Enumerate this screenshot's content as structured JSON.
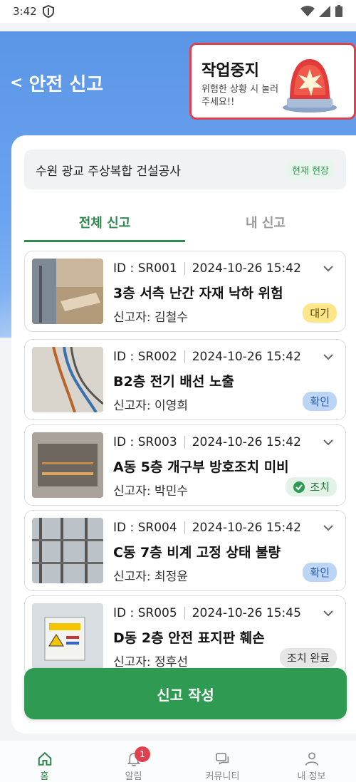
{
  "status_bar": {
    "time": "3:42"
  },
  "header": {
    "back_symbol": "<",
    "title": "안전 신고"
  },
  "stop_work": {
    "title": "작업중지",
    "subtitle": "위험한 상황 시 눌러주세요!!"
  },
  "site": {
    "name": "수원 광교 주상복합 건설공사",
    "badge": "현재 현장"
  },
  "tabs": [
    {
      "label": "전체 신고",
      "active": true
    },
    {
      "label": "내 신고",
      "active": false
    }
  ],
  "reports": [
    {
      "id": "ID : SR001",
      "datetime": "2024-10-26 15:42",
      "title": "3층 서측 난간 자재 낙하 위험",
      "reporter": "신고자: 김철수",
      "status": "대기",
      "status_type": "wait"
    },
    {
      "id": "ID : SR002",
      "datetime": "2024-10-26 15:42",
      "title": "B2층 전기 배선 노출",
      "reporter": "신고자: 이영희",
      "status": "확인",
      "status_type": "confirm"
    },
    {
      "id": "ID : SR003",
      "datetime": "2024-10-26 15:42",
      "title": "A동 5층 개구부 방호조치 미비",
      "reporter": "신고자: 박민수",
      "status": "조치",
      "status_type": "done"
    },
    {
      "id": "ID : SR004",
      "datetime": "2024-10-26 15:42",
      "title": "C동 7층 비계 고정 상태 불량",
      "reporter": "신고자: 최정윤",
      "status": "확인",
      "status_type": "confirm"
    },
    {
      "id": "ID : SR005",
      "datetime": "2024-10-26 15:45",
      "title": "D동 2층 안전 표지판 훼손",
      "reporter": "신고자: 정후선",
      "status": "조치 완료",
      "status_type": "complete"
    }
  ],
  "cta": {
    "label": "신고 작성"
  },
  "bottom_nav": [
    {
      "label": "홈",
      "icon": "home-icon",
      "active": true
    },
    {
      "label": "알림",
      "icon": "bell-icon",
      "badge": "1"
    },
    {
      "label": "커뮤니티",
      "icon": "chat-icon"
    },
    {
      "label": "내 정보",
      "icon": "person-icon"
    }
  ],
  "colors": {
    "primary_green": "#2e9a52",
    "header_blue": "#5b95e6",
    "alert_red": "#e0414f"
  }
}
